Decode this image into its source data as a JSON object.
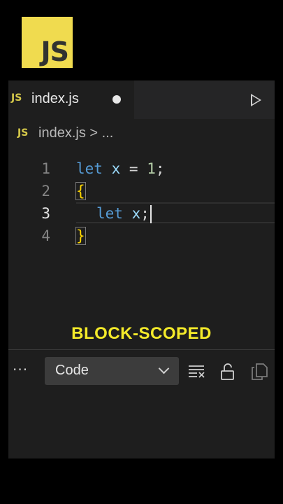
{
  "logo": {
    "text": "JS"
  },
  "tab": {
    "icon_text": "JS",
    "filename": "index.js"
  },
  "breadcrumb": {
    "icon_text": "JS",
    "path": "index.js > ..."
  },
  "code": {
    "lines": [
      {
        "num": "1"
      },
      {
        "num": "2"
      },
      {
        "num": "3"
      },
      {
        "num": "4"
      }
    ],
    "line1": {
      "kw": "let",
      "var": "x",
      "op": " = ",
      "num": "1",
      "end": ";"
    },
    "line2": {
      "brace": "{"
    },
    "line3": {
      "kw": "let",
      "var": "x",
      "end": ";"
    },
    "line4": {
      "brace": "}"
    }
  },
  "banner": {
    "text": "BLOCK-SCOPED"
  },
  "panel": {
    "more": "···",
    "select_value": "Code"
  },
  "icons": [
    "play-icon",
    "more-icon",
    "chevron-down-icon",
    "clear-output-icon",
    "lock-icon",
    "copy-icon"
  ],
  "colors": {
    "js_yellow": "#f0db4f",
    "banner_yellow": "#f4ea2a",
    "keyword": "#569cd6",
    "variable": "#9cdcfe",
    "number": "#b5cea8"
  }
}
